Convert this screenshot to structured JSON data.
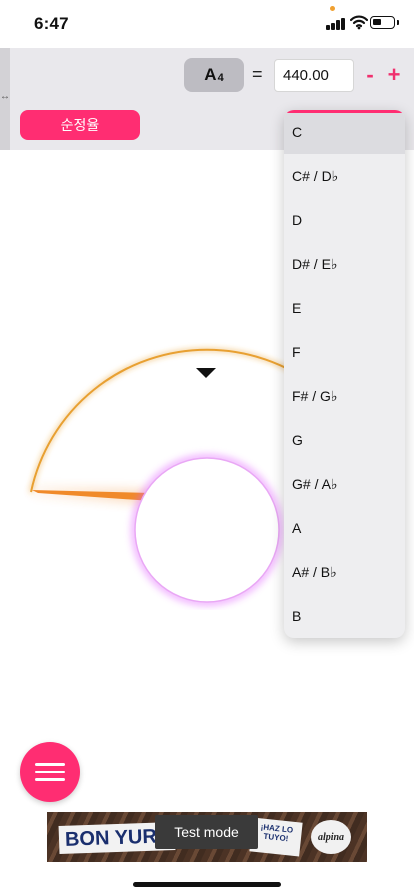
{
  "status_bar": {
    "time": "6:47",
    "battery_level": 0.4
  },
  "reference": {
    "note_letter": "A",
    "note_octave": "4",
    "equals": "=",
    "frequency": "440.00",
    "minus_label": "-",
    "plus_label": "+"
  },
  "temperament_label": "순정율",
  "note_dropdown": {
    "options": [
      "C",
      "C# / D♭",
      "D",
      "D# / E♭",
      "E",
      "F",
      "F# / G♭",
      "G",
      "G# / A♭",
      "A",
      "A# / B♭",
      "B"
    ],
    "highlighted": "C"
  },
  "ad": {
    "brand": "BON YURT",
    "tag": "¡HAZ LO TUYO!",
    "logo": "alpina",
    "test_mode": "Test mode"
  },
  "colors": {
    "accent": "#ff2d72",
    "toolbar_bg": "#e9e8ec",
    "arc": "#e8a030",
    "needle": "#f08a2a",
    "center_glow": "#e05cff"
  },
  "icons": [
    "cellular-signal-icon",
    "wifi-icon",
    "battery-icon",
    "resize-handle-icon",
    "pitch-pointer-icon",
    "hamburger-menu-icon"
  ]
}
